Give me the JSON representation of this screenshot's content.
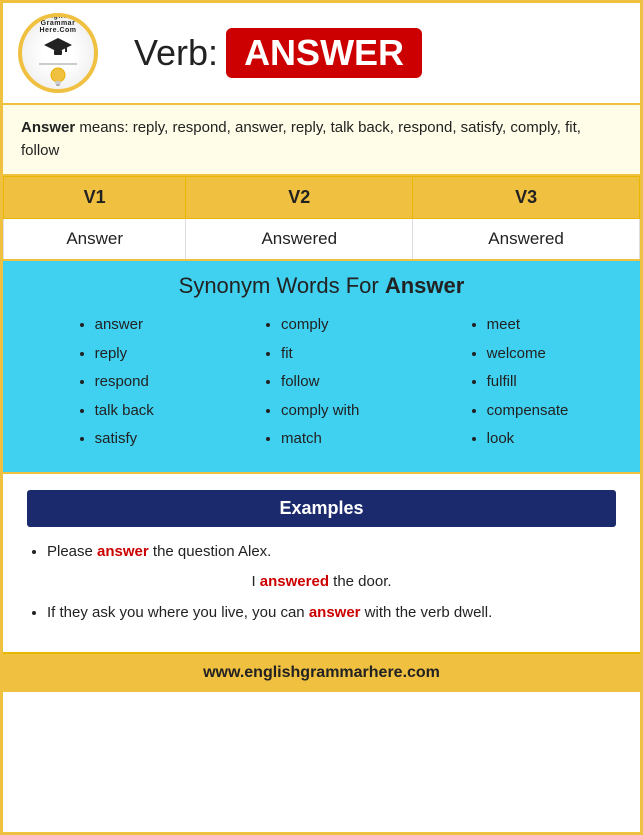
{
  "header": {
    "logo_text_line1": "English",
    "logo_text_line2": "Grammar",
    "logo_text_line3": "Here.Com",
    "verb_label": "Verb:",
    "word": "ANSWER"
  },
  "meaning": {
    "bold_word": "Answer",
    "text": " means: reply, respond, answer, reply, talk back, respond, satisfy, comply, fit, follow"
  },
  "table": {
    "headers": [
      "V1",
      "V2",
      "V3"
    ],
    "row": [
      "Answer",
      "Answered",
      "Answered"
    ]
  },
  "synonym": {
    "title_text": "Synonym Words For ",
    "title_bold": "Answer",
    "columns": [
      [
        "answer",
        "reply",
        "respond",
        "talk back",
        "satisfy"
      ],
      [
        "comply",
        "fit",
        "follow",
        "comply with",
        "match"
      ],
      [
        "meet",
        "welcome",
        "fulfill",
        "compensate",
        "look"
      ]
    ]
  },
  "examples": {
    "header": "Examples",
    "items": [
      {
        "before": "Please ",
        "red": "answer",
        "after": " the question Alex."
      },
      {
        "before": "I ",
        "red": "answered",
        "after": " the door."
      },
      {
        "before": "If they ask you where you live, you can ",
        "red": "answer",
        "after": " with the verb dwell."
      }
    ]
  },
  "footer": {
    "url": "www.englishgrammarhere.com"
  }
}
